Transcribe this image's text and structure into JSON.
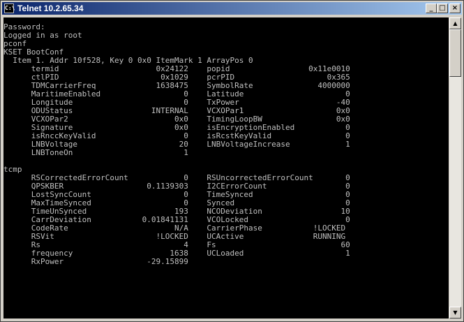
{
  "window": {
    "title": "Telnet 10.2.65.34",
    "app_icon_label": "C:\\",
    "minimize_glyph": "_",
    "maximize_glyph": "□",
    "close_glyph": "×"
  },
  "scrollbar": {
    "up_glyph": "▲",
    "down_glyph": "▼"
  },
  "terminal_lines": [
    "Password:",
    "Logged in as root",
    "pconf",
    "KSET BootConf",
    "  Item 1. Addr 10f528, Key 0 0x0 ItemMark 1 ArrayPos 0",
    "      termid                     0x24122    popid                 0x11e0010",
    "      ctlPID                      0x1029    pcrPID                    0x365",
    "      TDMCarrierFreq             1638475    SymbolRate              4000000",
    "      MaritimeEnabled                  0    Latitude                      0",
    "      Longitude                        0    TxPower                     -40",
    "      ODUStatus                 INTERNAL    VCXOPar1                    0x0",
    "      VCXOPar2                       0x0    TimingLoopBW                0x0",
    "      Signature                      0x0    isEncryptionEnabled           0",
    "      isRnccKeyValid                   0    isRcstKeyValid                0",
    "      LNBVoltage                      20    LNBVoltageIncrease            1",
    "      LNBToneOn                        1",
    "",
    "tcmp",
    "      RSCorrectedErrorCount            0    RSUncorrectedErrorCount       0",
    "      QPSKBER                  0.1139303    I2CErrorCount                 0",
    "      LostSyncCount                    0    TimeSynced                    0",
    "      MaxTimeSynced                    0    Synced                        0",
    "      TimeUnSynced                   193    NCODeviation                 10",
    "      CarrDeviation           0.01841131    VCOLocked                     0",
    "      CodeRate                       N/A    CarrierPhase           !LOCKED",
    "      RSVit                      !LOCKED    UCActive               RUNNING",
    "      Rs                               4    Fs                           60",
    "      frequency                     1638    UCLoaded                      1",
    "      RxPower                  -29.15899"
  ]
}
